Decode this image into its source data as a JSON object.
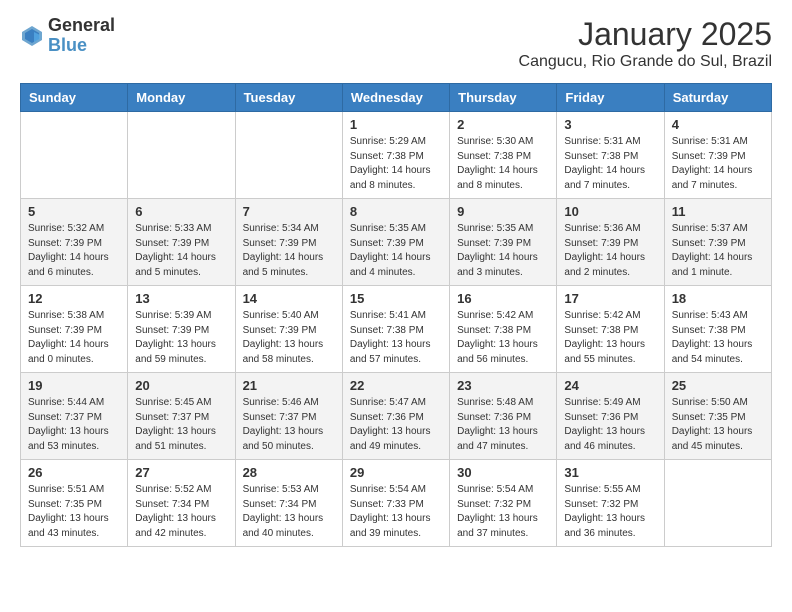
{
  "logo": {
    "general": "General",
    "blue": "Blue"
  },
  "header": {
    "month": "January 2025",
    "location": "Cangucu, Rio Grande do Sul, Brazil"
  },
  "days_of_week": [
    "Sunday",
    "Monday",
    "Tuesday",
    "Wednesday",
    "Thursday",
    "Friday",
    "Saturday"
  ],
  "weeks": [
    [
      {
        "num": "",
        "info": ""
      },
      {
        "num": "",
        "info": ""
      },
      {
        "num": "",
        "info": ""
      },
      {
        "num": "1",
        "info": "Sunrise: 5:29 AM\nSunset: 7:38 PM\nDaylight: 14 hours\nand 8 minutes."
      },
      {
        "num": "2",
        "info": "Sunrise: 5:30 AM\nSunset: 7:38 PM\nDaylight: 14 hours\nand 8 minutes."
      },
      {
        "num": "3",
        "info": "Sunrise: 5:31 AM\nSunset: 7:38 PM\nDaylight: 14 hours\nand 7 minutes."
      },
      {
        "num": "4",
        "info": "Sunrise: 5:31 AM\nSunset: 7:39 PM\nDaylight: 14 hours\nand 7 minutes."
      }
    ],
    [
      {
        "num": "5",
        "info": "Sunrise: 5:32 AM\nSunset: 7:39 PM\nDaylight: 14 hours\nand 6 minutes."
      },
      {
        "num": "6",
        "info": "Sunrise: 5:33 AM\nSunset: 7:39 PM\nDaylight: 14 hours\nand 5 minutes."
      },
      {
        "num": "7",
        "info": "Sunrise: 5:34 AM\nSunset: 7:39 PM\nDaylight: 14 hours\nand 5 minutes."
      },
      {
        "num": "8",
        "info": "Sunrise: 5:35 AM\nSunset: 7:39 PM\nDaylight: 14 hours\nand 4 minutes."
      },
      {
        "num": "9",
        "info": "Sunrise: 5:35 AM\nSunset: 7:39 PM\nDaylight: 14 hours\nand 3 minutes."
      },
      {
        "num": "10",
        "info": "Sunrise: 5:36 AM\nSunset: 7:39 PM\nDaylight: 14 hours\nand 2 minutes."
      },
      {
        "num": "11",
        "info": "Sunrise: 5:37 AM\nSunset: 7:39 PM\nDaylight: 14 hours\nand 1 minute."
      }
    ],
    [
      {
        "num": "12",
        "info": "Sunrise: 5:38 AM\nSunset: 7:39 PM\nDaylight: 14 hours\nand 0 minutes."
      },
      {
        "num": "13",
        "info": "Sunrise: 5:39 AM\nSunset: 7:39 PM\nDaylight: 13 hours\nand 59 minutes."
      },
      {
        "num": "14",
        "info": "Sunrise: 5:40 AM\nSunset: 7:39 PM\nDaylight: 13 hours\nand 58 minutes."
      },
      {
        "num": "15",
        "info": "Sunrise: 5:41 AM\nSunset: 7:38 PM\nDaylight: 13 hours\nand 57 minutes."
      },
      {
        "num": "16",
        "info": "Sunrise: 5:42 AM\nSunset: 7:38 PM\nDaylight: 13 hours\nand 56 minutes."
      },
      {
        "num": "17",
        "info": "Sunrise: 5:42 AM\nSunset: 7:38 PM\nDaylight: 13 hours\nand 55 minutes."
      },
      {
        "num": "18",
        "info": "Sunrise: 5:43 AM\nSunset: 7:38 PM\nDaylight: 13 hours\nand 54 minutes."
      }
    ],
    [
      {
        "num": "19",
        "info": "Sunrise: 5:44 AM\nSunset: 7:37 PM\nDaylight: 13 hours\nand 53 minutes."
      },
      {
        "num": "20",
        "info": "Sunrise: 5:45 AM\nSunset: 7:37 PM\nDaylight: 13 hours\nand 51 minutes."
      },
      {
        "num": "21",
        "info": "Sunrise: 5:46 AM\nSunset: 7:37 PM\nDaylight: 13 hours\nand 50 minutes."
      },
      {
        "num": "22",
        "info": "Sunrise: 5:47 AM\nSunset: 7:36 PM\nDaylight: 13 hours\nand 49 minutes."
      },
      {
        "num": "23",
        "info": "Sunrise: 5:48 AM\nSunset: 7:36 PM\nDaylight: 13 hours\nand 47 minutes."
      },
      {
        "num": "24",
        "info": "Sunrise: 5:49 AM\nSunset: 7:36 PM\nDaylight: 13 hours\nand 46 minutes."
      },
      {
        "num": "25",
        "info": "Sunrise: 5:50 AM\nSunset: 7:35 PM\nDaylight: 13 hours\nand 45 minutes."
      }
    ],
    [
      {
        "num": "26",
        "info": "Sunrise: 5:51 AM\nSunset: 7:35 PM\nDaylight: 13 hours\nand 43 minutes."
      },
      {
        "num": "27",
        "info": "Sunrise: 5:52 AM\nSunset: 7:34 PM\nDaylight: 13 hours\nand 42 minutes."
      },
      {
        "num": "28",
        "info": "Sunrise: 5:53 AM\nSunset: 7:34 PM\nDaylight: 13 hours\nand 40 minutes."
      },
      {
        "num": "29",
        "info": "Sunrise: 5:54 AM\nSunset: 7:33 PM\nDaylight: 13 hours\nand 39 minutes."
      },
      {
        "num": "30",
        "info": "Sunrise: 5:54 AM\nSunset: 7:32 PM\nDaylight: 13 hours\nand 37 minutes."
      },
      {
        "num": "31",
        "info": "Sunrise: 5:55 AM\nSunset: 7:32 PM\nDaylight: 13 hours\nand 36 minutes."
      },
      {
        "num": "",
        "info": ""
      }
    ]
  ]
}
